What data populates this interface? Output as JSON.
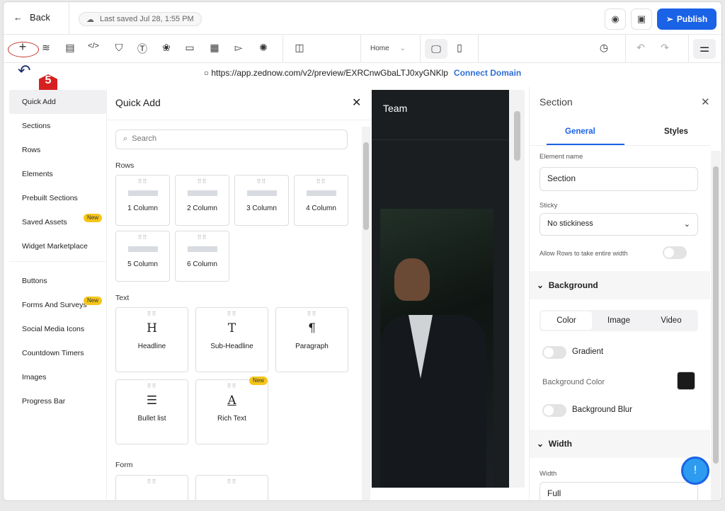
{
  "header": {
    "back": "Back",
    "saved": "Last saved Jul 28, 1:55 PM",
    "publish": "Publish"
  },
  "toolbar": {
    "page_select": "Home",
    "annotation_step": "5"
  },
  "url": {
    "address": "https://app.zednow.com/v2/preview/EXRCnwGbaLTJ0xyGNKlp",
    "connect": "Connect Domain"
  },
  "nav": {
    "items": [
      "Quick Add",
      "Sections",
      "Rows",
      "Elements",
      "Prebuilt Sections",
      "Saved Assets",
      "Widget Marketplace",
      "Buttons",
      "Forms And Surveys",
      "Social Media Icons",
      "Countdown Timers",
      "Images",
      "Progress Bar"
    ],
    "new_badge": "New"
  },
  "quick_add": {
    "title": "Quick Add",
    "search_placeholder": "Search",
    "rows_label": "Rows",
    "rows": [
      "1 Column",
      "2 Column",
      "3 Column",
      "4 Column",
      "5 Column",
      "6 Column"
    ],
    "text_label": "Text",
    "text": [
      "Headline",
      "Sub-Headline",
      "Paragraph",
      "Bullet list",
      "Rich Text"
    ],
    "form_label": "Form"
  },
  "canvas": {
    "heading": "Team"
  },
  "panel": {
    "title": "Section",
    "tabs": [
      "General",
      "Styles"
    ],
    "element_name_label": "Element name",
    "element_name": "Section",
    "sticky_label": "Sticky",
    "sticky": "No stickiness",
    "allow_rows": "Allow Rows to take entire width",
    "background": "Background",
    "bg_tabs": [
      "Color",
      "Image",
      "Video"
    ],
    "gradient": "Gradient",
    "bg_color": "Background Color",
    "bg_blur": "Background Blur",
    "width_section": "Width",
    "width_label": "Width",
    "width": "Full",
    "swatch": "#1a1a1a"
  }
}
